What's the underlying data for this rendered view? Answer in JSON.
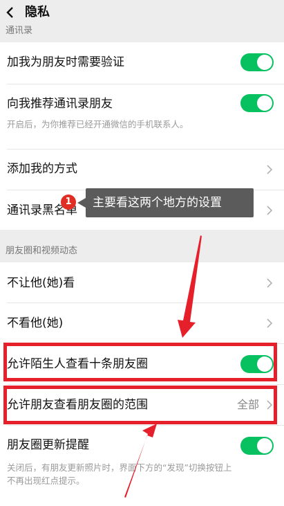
{
  "header": {
    "title": "隐私"
  },
  "sections": {
    "contacts_header": "通讯录",
    "moments_header": "朋友圈和视频动态"
  },
  "rows": {
    "verify": {
      "label": "加我为朋友时需要验证",
      "on": true
    },
    "recommend": {
      "label": "向我推荐通讯录朋友",
      "sub": "开启后，为你推荐已经开通微信的手机联系人。",
      "on": true
    },
    "add_methods": {
      "label": "添加我的方式"
    },
    "blacklist": {
      "label": "通讯录黑名单"
    },
    "hide_from": {
      "label": "不让他(她)看"
    },
    "dont_see": {
      "label": "不看他(她)"
    },
    "strangers": {
      "label": "允许陌生人查看十条朋友圈",
      "on": true
    },
    "range": {
      "label": "允许朋友查看朋友圈的范围",
      "value": "全部"
    },
    "updates": {
      "label": "朋友圈更新提醒",
      "sub1": "关闭后，有朋友更新照片时，界面下方的“发现”切换按钮上",
      "sub2": "不再出现红点提示。",
      "on": true
    }
  },
  "annotation": {
    "badge": "1",
    "tooltip": "主要看这两个地方的设置",
    "color": "#e6202b"
  },
  "colors": {
    "toggle_on": "#07c160",
    "background": "#ededed"
  }
}
